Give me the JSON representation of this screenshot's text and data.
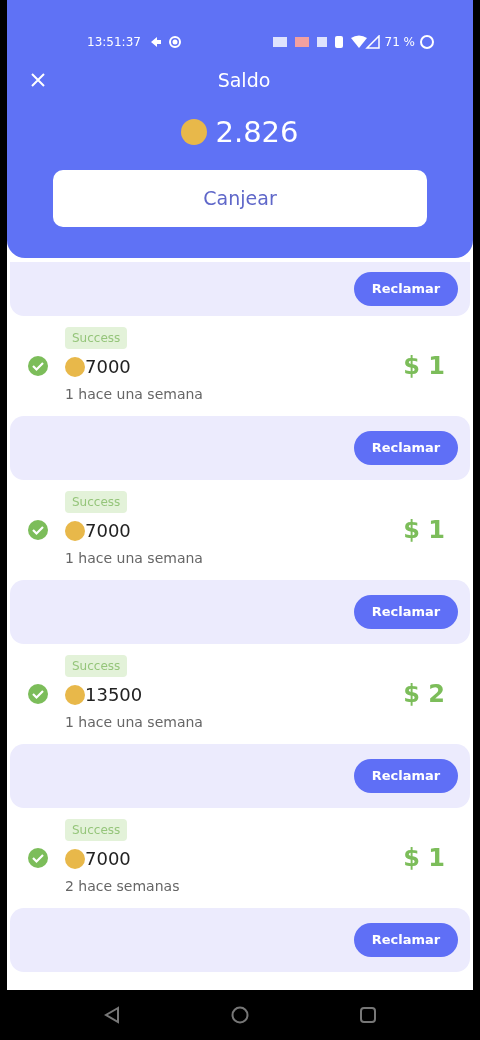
{
  "status_bar": {
    "time": "13:51:37",
    "battery": "71 %"
  },
  "header": {
    "title": "Saldo",
    "balance": "2.826",
    "button": "Canjear"
  },
  "entries": [
    {
      "kind": "claim",
      "button": "Reclamar"
    },
    {
      "kind": "record",
      "status": "Success",
      "coins": "7000",
      "amount": "$ 1",
      "time": "1 hace una semana"
    },
    {
      "kind": "claim",
      "button": "Reclamar"
    },
    {
      "kind": "record",
      "status": "Success",
      "coins": "7000",
      "amount": "$ 1",
      "time": "1 hace una semana"
    },
    {
      "kind": "claim",
      "button": "Reclamar"
    },
    {
      "kind": "record",
      "status": "Success",
      "coins": "13500",
      "amount": "$ 2",
      "time": "1 hace una semana"
    },
    {
      "kind": "claim",
      "button": "Reclamar"
    },
    {
      "kind": "record",
      "status": "Success",
      "coins": "7000",
      "amount": "$ 1",
      "time": "2 hace semanas"
    },
    {
      "kind": "claim",
      "button": "Reclamar"
    }
  ]
}
